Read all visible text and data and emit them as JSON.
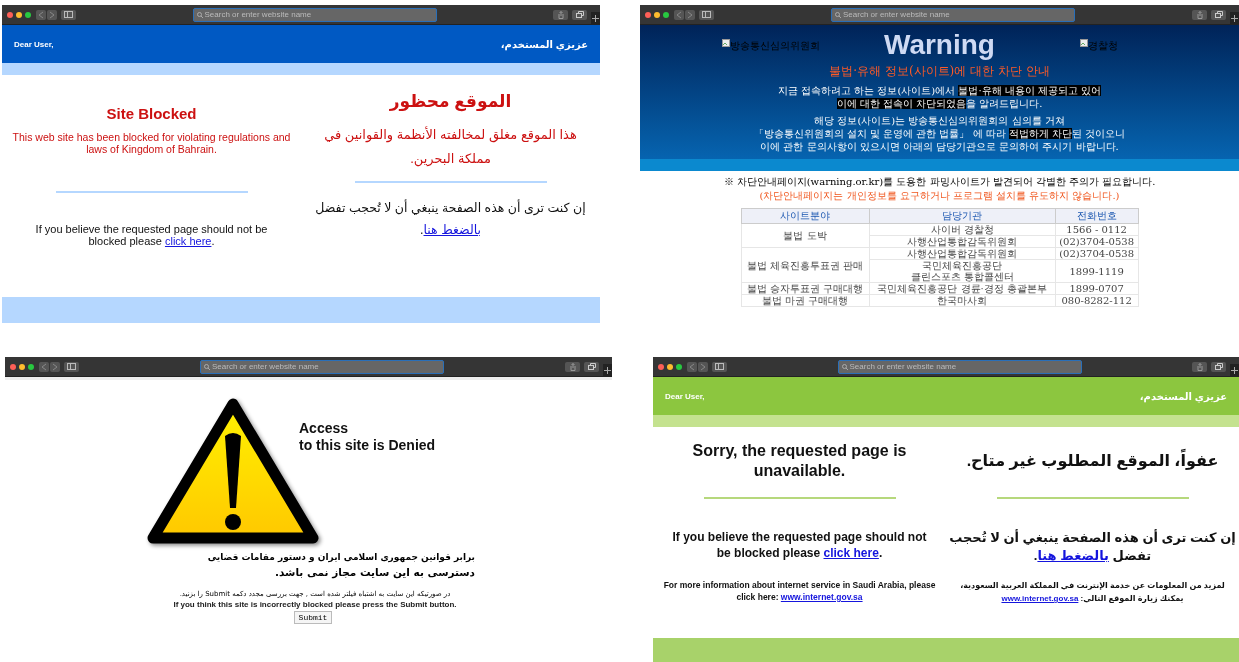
{
  "windows": [
    {
      "kind": "bahrain",
      "search": {
        "placeholder": "Search or enter website name"
      },
      "header": {
        "left": "Dear User,",
        "right": "عزيزي المستخدم،"
      },
      "english": {
        "title": "Site Blocked",
        "message": "This web site has been blocked for violating regulations and laws of Kingdom of Bahrain.",
        "appeal": {
          "before": "If you believe the requested page should not be blocked please ",
          "link": "click here",
          "after": "."
        }
      },
      "arabic": {
        "title": "الموقع محظور",
        "message": "هذا الموقع مغلق لمخالفته الأنظمة والقوانين في مملكة البحرين.",
        "appeal": {
          "before": "إن كنت ترى أن هذه الصفحة ينبغي أن لا تُحجب تفضل ",
          "link": "بالضغط هنا",
          "after": "."
        }
      }
    },
    {
      "kind": "korea",
      "search": {
        "placeholder": "Search or enter website name"
      },
      "title": "Warning",
      "images": [
        "방송통신심의위원회",
        "경찰청"
      ],
      "subtitle": "불법·유해 정보(사이트)에 대한 차단 안내",
      "paragraphs": [
        [
          "지금 접속하려고 하는 정보(사이트)에서 **불법·유해 내용이 제공되고 있어**",
          "**이에 대한 접속이 차단되었음**을 알려드립니다."
        ],
        [
          "해당 정보(사이트)는 방송통신심의위원회의 심의를 거쳐",
          "「방송통신위원회의 설치 및 운영에 관한 법률」 에 따라 **적법하게 차단**된 것이오니",
          "이에 관한 문의사항이 있으시면 아래의 담당기관으로 문의하여 주시기 바랍니다."
        ]
      ],
      "notice": "※ 차단안내페이지(warning.or.kr)를 도용한 파밍사이트가 발견되어 각별한 주의가 필요합니다.",
      "notice_note": "(차단안내페이지는 개인정보를 요구하거나 프로그램 설치를 유도하지 않습니다.)",
      "table": {
        "columns": [
          "사이트분야",
          "담당기관",
          "전화번호"
        ],
        "rows": [
          {
            "category": "불법 도박",
            "entries": [
              {
                "agency": "사이버 경찰청",
                "phone": "1566 - 0112"
              },
              {
                "agency": "사행산업통합감독위원회",
                "phone": "(02)3704-0538"
              }
            ]
          },
          {
            "category": "불법 체육진흥투표권 판매",
            "entries": [
              {
                "agency": "사행산업통합감독위원회",
                "phone": "(02)3704-0538"
              },
              {
                "agency": "국민체육진흥공단\n클린스포츠 통합콜센터",
                "phone": "1899-1119"
              }
            ]
          },
          {
            "category": "불법 승자투표권 구매대행",
            "entries": [
              {
                "agency": "국민체육진흥공단 경륜·경정 총괄본부",
                "phone": "1899-0707"
              }
            ]
          },
          {
            "category": "불법 마권 구매대행",
            "entries": [
              {
                "agency": "한국마사회",
                "phone": "080-8282-112"
              }
            ]
          }
        ]
      }
    },
    {
      "kind": "iran",
      "search": {
        "placeholder": "Search or enter website name"
      },
      "title_lines": [
        "Access",
        "to this site is Denied"
      ],
      "farsi_lines": [
        "برابر قوانین جمهوری اسلامی ایران و دستور مقامات قضایی",
        "دسترسی به این سایت مجاز نمی باشد."
      ],
      "farsi_note": "در صورتیکه این سایت به اشتباه فیلتر شده است , جهت بررسی مجدد دکمه Submit را بزنید.",
      "english_note": "If you think this site is incorrectly blocked please press the Submit button.",
      "button": "Submit"
    },
    {
      "kind": "saudi",
      "search": {
        "placeholder": "Search or enter website name"
      },
      "header": {
        "left": "Dear User,",
        "right": "عزيزي المستخدم،"
      },
      "english": {
        "title": "Sorry, the requested page is unavailable.",
        "appeal": {
          "before": "If you believe the requested page should not be blocked please ",
          "link": "click here",
          "after": "."
        },
        "footer": {
          "before": "For more information about internet service in Saudi Arabia, please click here: ",
          "link": "www.internet.gov.sa"
        }
      },
      "arabic": {
        "title": "عفواً، الموقع المطلوب غير متاح.",
        "appeal": {
          "before": "إن كنت ترى أن هذه الصفحة ينبغي أن لا تُحجب تفضل ",
          "link": "بالضغط هنا",
          "after": "."
        },
        "footer": {
          "before": "لمزيد من المعلومات عن خدمة الإنترنت في المملكة العربية السعودية، يمكنك زيارة الموقع التالي: ",
          "link": "www.internet.gov.sa"
        }
      }
    }
  ]
}
